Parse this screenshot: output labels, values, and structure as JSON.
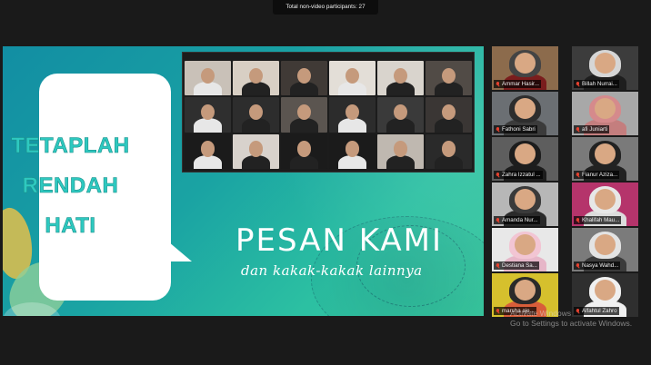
{
  "topbar": {
    "label": "Total non-video participants: 27"
  },
  "shared_screen": {
    "bubble_lines": [
      "TETAPLAH",
      "RENDAH",
      "HATI"
    ],
    "title": "PESAN KAMI",
    "subtitle": "dan kakak-kakak lainnya"
  },
  "sidebar": {
    "participants": [
      {
        "name": "Ammar Hasir...",
        "bg": "#8c6b4c",
        "hijab": "#444444",
        "body": "#7a1d1d"
      },
      {
        "name": "Billah Nurrai...",
        "bg": "#3c3c3c",
        "hijab": "#d6d6d6",
        "body": "#1e1e1e"
      },
      {
        "name": "Fathoni Sabri",
        "bg": "#6b6f73",
        "hijab": "#2d2d2d",
        "body": "#3b3b3b"
      },
      {
        "name": "afi Juniarti",
        "bg": "#a8a8a8",
        "hijab": "#d58a8c",
        "body": "#c47e7e"
      },
      {
        "name": "Zahra Izzatul ...",
        "bg": "#5e5e5e",
        "hijab": "#1d1d1d",
        "body": "#1d1d1d"
      },
      {
        "name": "Fianur Aziza...",
        "bg": "#7a7a7a",
        "hijab": "#222222",
        "body": "#222222"
      },
      {
        "name": "Amanda Nur...",
        "bg": "#b7b7b7",
        "hijab": "#3a3a3a",
        "body": "#2a2a2a"
      },
      {
        "name": "Khalifah Mau...",
        "bg": "#b5346b",
        "hijab": "#e7e7e7",
        "body": "#dcdcdc"
      },
      {
        "name": "Destiana Sa...",
        "bg": "#e8e8e8",
        "hijab": "#f2c5d3",
        "body": "#e6b6c8"
      },
      {
        "name": "Nasya Wahd...",
        "bg": "#7b7b7b",
        "hijab": "#e3e3e3",
        "body": "#3b3b3b"
      },
      {
        "name": "marsha aje...",
        "bg": "#d6c02d",
        "hijab": "#2a2a2a",
        "body": "#d85e3a"
      },
      {
        "name": "Alfahtul Zahro",
        "bg": "#2f2f2f",
        "hijab": "#f0f0f0",
        "body": "#f0f0f0"
      }
    ]
  },
  "meeting_thumbs": [
    "#c9c1b8",
    "#d8cfc4",
    "#403a36",
    "#e3ded7",
    "#d9d4cd",
    "#514b46",
    "#2f2f2f",
    "#2d2d2d",
    "#5b5550",
    "#2c2c2c",
    "#3a3a3a",
    "#3a3634",
    "#1b1b1b",
    "#d8d2cc",
    "#1b1b1b",
    "#1b1b1b",
    "#bfb8b0",
    "#2a2a2a"
  ],
  "watermark": {
    "line1": "Activate Windows",
    "line2": "Go to Settings to activate Windows."
  }
}
